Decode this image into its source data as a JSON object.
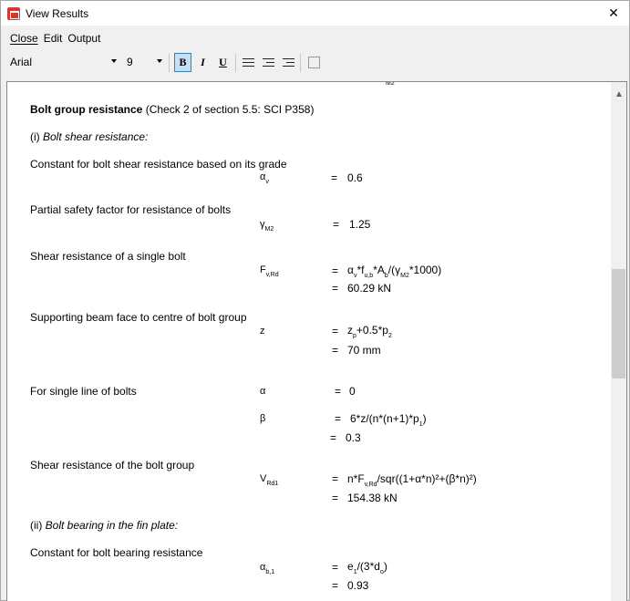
{
  "window": {
    "title": "View Results",
    "close_glyph": "✕"
  },
  "menu": {
    "close": "Close",
    "edit": "Edit",
    "output": "Output"
  },
  "toolbar": {
    "font": "Arial",
    "size": "9",
    "bold": "B",
    "italic": "I",
    "underline": "U"
  },
  "doc": {
    "top_fragment": "M2",
    "heading_bold": "Bolt group resistance",
    "heading_rest": " (Check 2 of section 5.5: SCI P358)",
    "section_i_prefix": "(i) ",
    "section_i": "Bolt shear resistance:",
    "r1_label": "Constant for bolt shear resistance based on its grade",
    "r1_sym": "α",
    "r1_sub": "v",
    "r1_eq": "=",
    "r1_val": "0.6",
    "r2_label": "Partial safety factor for resistance of bolts",
    "r2_sym": "γ",
    "r2_sub": "M2",
    "r2_eq": "=",
    "r2_val": "1.25",
    "r3_label": "Shear resistance of a single bolt",
    "r3_sym": "F",
    "r3_sub": "v,Rd",
    "r3_eq1": "=",
    "r3_f1": "α",
    "r3_f1s": "v",
    "r3_f2": "*f",
    "r3_f2s": "u,b",
    "r3_f3": "*A",
    "r3_f3s": "b",
    "r3_f4": "/(γ",
    "r3_f4s": "M2",
    "r3_f5": "*1000)",
    "r3_eq2": "=",
    "r3_val": "60.29 kN",
    "r4_label": "Supporting beam face to centre of bolt group",
    "r4_sym": "z",
    "r4_eq1": "=",
    "r4_f1": "z",
    "r4_f1s": "p",
    "r4_f2": "+0.5*p",
    "r4_f2s": "2",
    "r4_eq2": "=",
    "r4_val": "70 mm",
    "r5_label": "For single line of bolts",
    "r5_sym": "α",
    "r5_eq": "=",
    "r5_val": "0",
    "r6_sym": "β",
    "r6_eq1": "=",
    "r6_f1": "6*z/(n*(n+1)*p",
    "r6_f1s": "1",
    "r6_f2": ")",
    "r6_eq2": "=",
    "r6_val": "0.3",
    "r7_label": "Shear resistance of the bolt group",
    "r7_sym": "V",
    "r7_sub": "Rd1",
    "r7_eq1": "=",
    "r7_f1": "n*F",
    "r7_f1s": "v,Rd",
    "r7_f2": "/sqr((1+α*n)²+(β*n)²)",
    "r7_eq2": "=",
    "r7_val": "154.38 kN",
    "section_ii_prefix": "(ii) ",
    "section_ii": "Bolt bearing in the fin plate:",
    "r8_label": "Constant for bolt bearing resistance",
    "r8_sym": "α",
    "r8_sub": "b,1",
    "r8_eq1": "=",
    "r8_f1": "e",
    "r8_f1s": "1",
    "r8_f2": "/(3*d",
    "r8_f2s": "o",
    "r8_f3": ")",
    "r8_eq2": "=",
    "r8_val": "0.93"
  }
}
